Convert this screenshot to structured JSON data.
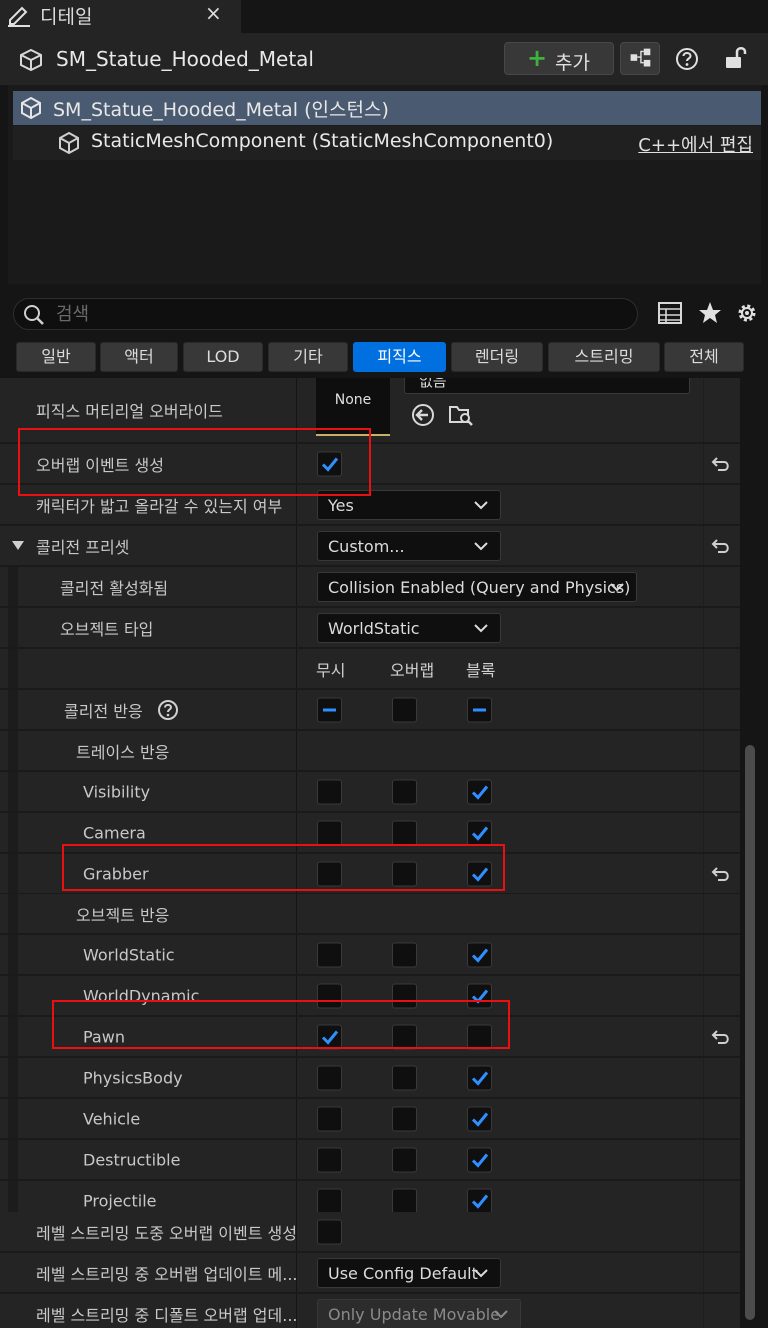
{
  "window": {
    "tab_title": "디테일",
    "close": "×"
  },
  "header": {
    "object_name": "SM_Statue_Hooded_Metal",
    "add_label": "추가",
    "add_plus": "+"
  },
  "components": {
    "root": "SM_Statue_Hooded_Metal (인스턴스)",
    "child": "StaticMeshComponent (StaticMeshComponent0)",
    "edit_link": "C++에서 편집"
  },
  "search": {
    "placeholder": "검색",
    "value": ""
  },
  "filter_tabs": [
    {
      "label": "일반",
      "active": false
    },
    {
      "label": "액터",
      "active": false
    },
    {
      "label": "LOD",
      "active": false
    },
    {
      "label": "기타",
      "active": false
    },
    {
      "label": "피직스",
      "active": true
    },
    {
      "label": "렌더링",
      "active": false
    },
    {
      "label": "스트리밍",
      "active": false
    },
    {
      "label": "전체",
      "active": false
    }
  ],
  "properties": {
    "phys_material_override": {
      "label": "피직스 머티리얼 오버라이드",
      "thumb": "None",
      "asset_value": "없음"
    },
    "generate_overlap": {
      "label": "오버랩 이벤트 생성",
      "checked": true,
      "has_reset": true
    },
    "can_step_up": {
      "label": "캐릭터가 밟고 올라갈 수 있는지 여부",
      "value": "Yes"
    },
    "collision_presets": {
      "label": "콜리전 프리셋",
      "value": "Custom...",
      "expanded": true,
      "has_reset": true
    },
    "collision_enabled": {
      "label": "콜리전 활성화됨",
      "value": "Collision Enabled (Query and Physics)"
    },
    "object_type": {
      "label": "오브젝트 타입",
      "value": "WorldStatic"
    },
    "response_headers": {
      "ignore": "무시",
      "overlap": "오버랩",
      "block": "블록"
    },
    "collision_responses": {
      "label": "콜리전 반응"
    },
    "trace_responses": {
      "label": "트레이스 반응"
    },
    "object_responses": {
      "label": "오브젝트 반응"
    },
    "level_streaming_overlap": {
      "label": "레벨 스트리밍 도중 오버랩 이벤트 생성",
      "checked": false
    },
    "update_overlaps_method": {
      "label": "레벨 스트리밍 중 오버랩 업데이트 메...",
      "value": "Use Config Default"
    },
    "default_update_overlaps": {
      "label": "레벨 스트리밍 중 디폴트 오버랩 업데...",
      "value": "Only Update Movable"
    }
  },
  "channels": [
    {
      "label": "Visibility",
      "ignore": false,
      "overlap": false,
      "block": true
    },
    {
      "label": "Camera",
      "ignore": false,
      "overlap": false,
      "block": true
    },
    {
      "label": "Grabber",
      "ignore": false,
      "overlap": false,
      "block": true
    },
    {
      "label": "WorldStatic",
      "ignore": false,
      "overlap": false,
      "block": true
    },
    {
      "label": "WorldDynamic",
      "ignore": false,
      "overlap": false,
      "block": true
    },
    {
      "label": "Pawn",
      "ignore": true,
      "overlap": false,
      "block": false
    },
    {
      "label": "PhysicsBody",
      "ignore": false,
      "overlap": false,
      "block": true
    },
    {
      "label": "Vehicle",
      "ignore": false,
      "overlap": false,
      "block": true
    },
    {
      "label": "Destructible",
      "ignore": false,
      "overlap": false,
      "block": true
    },
    {
      "label": "Projectile",
      "ignore": false,
      "overlap": false,
      "block": true
    }
  ],
  "colors": {
    "accent": "#0070e0",
    "highlight": "#e81010",
    "selection": "#4a5a70",
    "check": "#2e8fff"
  }
}
